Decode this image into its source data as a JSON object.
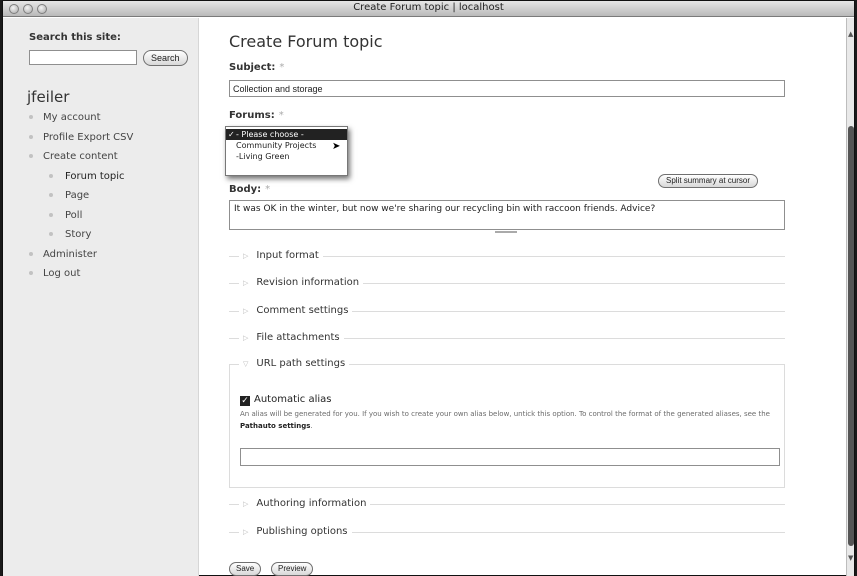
{
  "window": {
    "title": "Create Forum topic | localhost"
  },
  "sidebar": {
    "search_label": "Search this site:",
    "search_value": "",
    "search_button": "Search",
    "username": "jfeiler",
    "nav": [
      {
        "label": "My account",
        "level": 0
      },
      {
        "label": "Profile Export CSV",
        "level": 0
      },
      {
        "label": "Create content",
        "level": 0
      },
      {
        "label": "Forum topic",
        "level": 1,
        "active": true
      },
      {
        "label": "Page",
        "level": 1
      },
      {
        "label": "Poll",
        "level": 1
      },
      {
        "label": "Story",
        "level": 1
      },
      {
        "label": "Administer",
        "level": 0
      },
      {
        "label": "Log out",
        "level": 0
      }
    ]
  },
  "main": {
    "page_title": "Create Forum topic",
    "subject": {
      "label": "Subject:",
      "required": "*",
      "value": "Collection and storage"
    },
    "forums": {
      "label": "Forums:",
      "required": "*",
      "options": [
        {
          "label": "- Please choose -",
          "check": "✓"
        },
        {
          "label": "Community Projects"
        },
        {
          "label": "-Living Green"
        }
      ]
    },
    "split_button": "Split summary at cursor",
    "body": {
      "label": "Body:",
      "required": "*",
      "value": "It was OK in the winter, but now we're sharing our recycling bin with raccoon friends. Advice?"
    },
    "fieldsets": {
      "input_format": "Input format",
      "revision_information": "Revision information",
      "comment_settings": "Comment settings",
      "file_attachments": "File attachments",
      "url_path_settings": "URL path settings",
      "authoring_information": "Authoring information",
      "publishing_options": "Publishing options"
    },
    "url_path": {
      "automatic_alias_label": "Automatic alias",
      "automatic_alias_checked": true,
      "alias_description": "An alias will be generated for you. If you wish to create your own alias below, untick this option. To control the format of the generated aliases, see the",
      "alias_link": "Pathauto settings",
      "alias_period": ".",
      "alias_value": ""
    },
    "save_button": "Save",
    "preview_button": "Preview"
  }
}
